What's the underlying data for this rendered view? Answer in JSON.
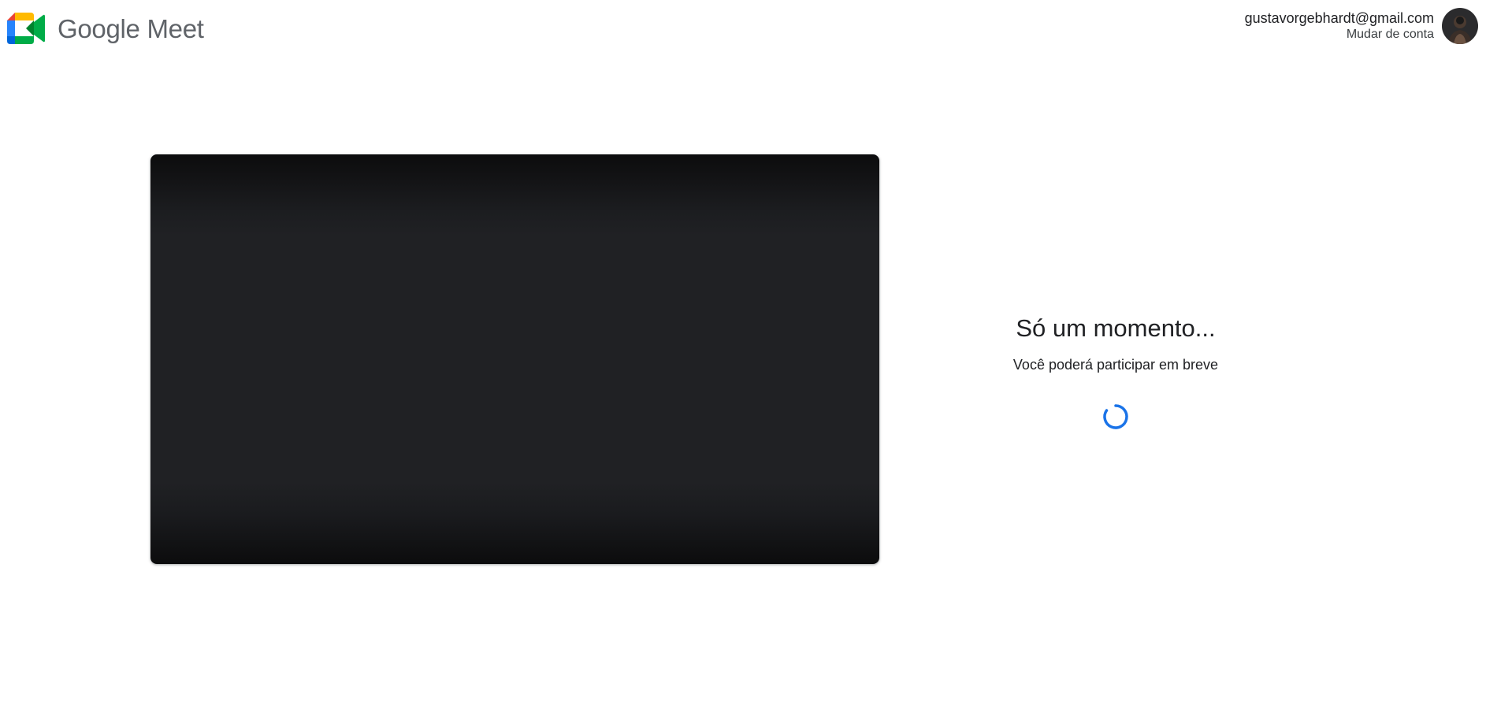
{
  "header": {
    "brand_name": "Google Meet",
    "logo_icon": "google-meet-logo-icon",
    "colors": {
      "logo_blue": "#2684fc",
      "logo_green": "#00ac47",
      "logo_yellow": "#ffba00",
      "logo_red": "#ea4335",
      "logo_dark_green": "#00832d",
      "logo_dark_blue": "#0066da"
    }
  },
  "account": {
    "email": "gustavorgebhardt@gmail.com",
    "switch_label": "Mudar de conta",
    "avatar_icon": "avatar-photo"
  },
  "preview": {
    "background": "#202124"
  },
  "status": {
    "title": "Só um momento...",
    "subtitle": "Você poderá participar em breve",
    "spinner_icon": "loading-spinner-icon",
    "spinner_color": "#1a73e8"
  }
}
